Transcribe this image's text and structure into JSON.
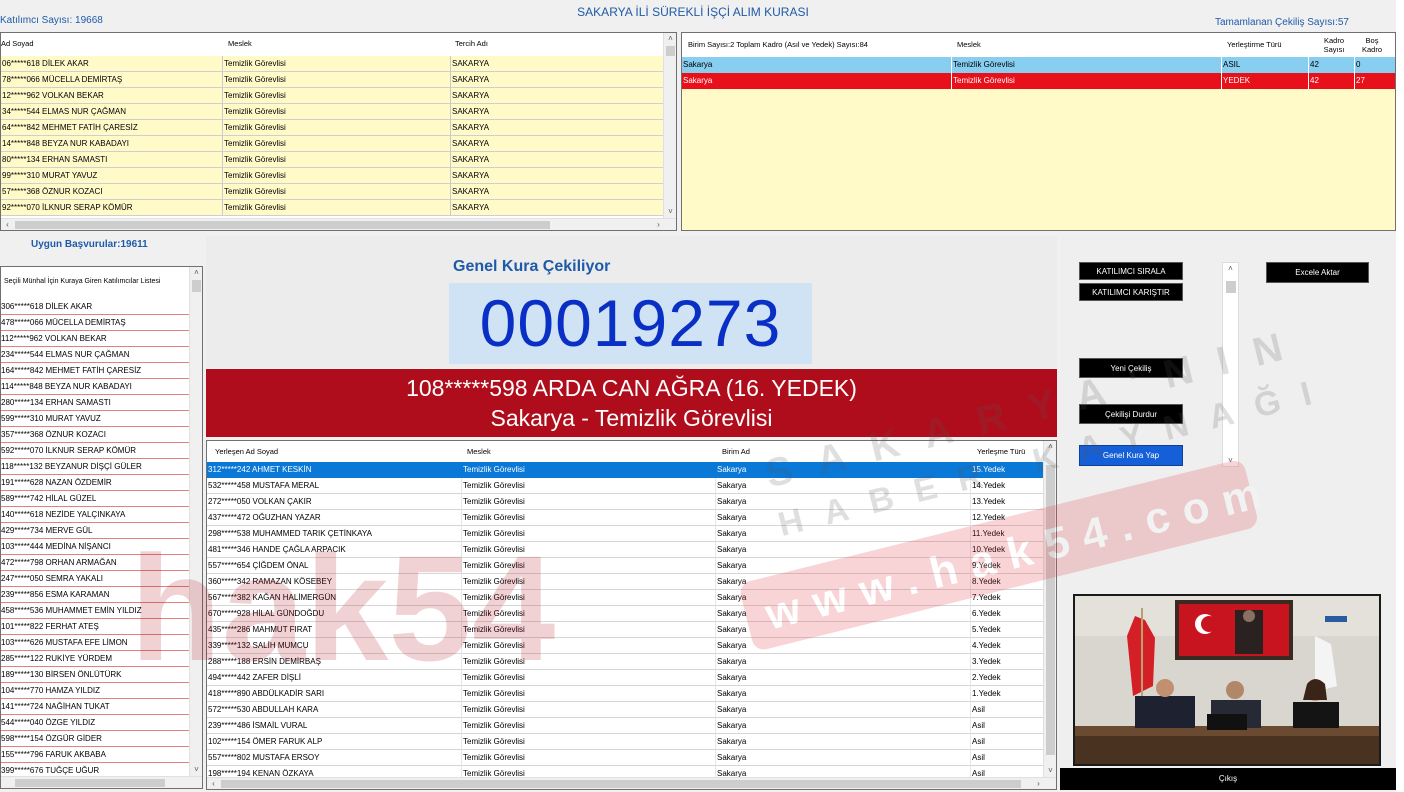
{
  "header": {
    "title": "SAKARYA İLİ SÜREKLİ İŞÇİ ALIM KURASI",
    "participants": "Katılımcı Sayısı: 19668",
    "completed": "Tamamlanan Çekiliş Sayısı:57"
  },
  "participant_grid": {
    "columns": [
      "Ad Soyad",
      "Meslek",
      "Tercih Adı"
    ],
    "rows": [
      [
        "06*****618 DİLEK AKAR",
        "Temizlik Görevlisi",
        "SAKARYA"
      ],
      [
        "78*****066 MÜCELLA DEMİRTAŞ",
        "Temizlik Görevlisi",
        "SAKARYA"
      ],
      [
        "12*****962 VOLKAN BEKAR",
        "Temizlik Görevlisi",
        "SAKARYA"
      ],
      [
        "34*****544 ELMAS NUR ÇAĞMAN",
        "Temizlik Görevlisi",
        "SAKARYA"
      ],
      [
        "64*****842 MEHMET FATİH ÇARESİZ",
        "Temizlik Görevlisi",
        "SAKARYA"
      ],
      [
        "14*****848 BEYZA NUR KABADAYI",
        "Temizlik Görevlisi",
        "SAKARYA"
      ],
      [
        "80*****134 ERHAN SAMASTI",
        "Temizlik Görevlisi",
        "SAKARYA"
      ],
      [
        "99*****310 MURAT YAVUZ",
        "Temizlik Görevlisi",
        "SAKARYA"
      ],
      [
        "57*****368 ÖZNUR KOZACI",
        "Temizlik Görevlisi",
        "SAKARYA"
      ],
      [
        "92*****070 İLKNUR SERAP KÖMÜR",
        "Temizlik Görevlisi",
        "SAKARYA"
      ]
    ]
  },
  "unit_grid": {
    "columns": [
      "Birim Sayısı:2 Toplam Kadro (Asıl ve Yedek) Sayısı:84",
      "Meslek",
      "Yerleştirme Türü",
      "Kadro Sayısı",
      "Boş Kadro"
    ],
    "rows": [
      [
        "Sakarya",
        "Temizlik Görevlisi",
        "ASIL",
        "42",
        "0"
      ],
      [
        "Sakarya",
        "Temizlik Görevlisi",
        "YEDEK",
        "42",
        "27"
      ]
    ],
    "row_colors": [
      "#87cef0",
      "#e8101a"
    ]
  },
  "eligible": {
    "title": "Uygun Başvurular:19611",
    "list_title": "Seçili Münhal İçin Kuraya Giren Katılımcılar Listesi",
    "items": [
      "306*****618 DİLEK AKAR",
      "478*****066 MÜCELLA DEMİRTAŞ",
      "112*****962 VOLKAN BEKAR",
      "234*****544 ELMAS NUR ÇAĞMAN",
      "164*****842 MEHMET FATİH ÇARESİZ",
      "114*****848 BEYZA NUR KABADAYI",
      "280*****134 ERHAN SAMASTI",
      "599*****310 MURAT YAVUZ",
      "357*****368 ÖZNUR KOZACI",
      "592*****070 İLKNUR SERAP KÖMÜR",
      "118*****132 BEYZANUR DİŞÇİ GÜLER",
      "191*****628 NAZAN ÖZDEMİR",
      "589*****742 HİLAL GÜZEL",
      "140*****618 NEZİDE YALÇINKAYA",
      "429*****734 MERVE GÜL",
      "103*****444 MEDİNA NİŞANCI",
      "472*****798 ORHAN ARMAĞAN",
      "247*****050 SEMRA YAKALI",
      "239*****856 ESMA KARAMAN",
      "458*****536 MUHAMMET EMİN YILDIZ",
      "101*****822 FERHAT ATEŞ",
      "103*****626 MUSTAFA EFE LİMON",
      "285*****122 RUKİYE YÜRDEM",
      "189*****130 BİRSEN ÖNLÜTÜRK",
      "104*****770 HAMZA YILDIZ",
      "141*****724 NAĞİHAN TUKAT",
      "544*****040 ÖZGE YILDIZ",
      "598*****154 ÖZGÜR GİDER",
      "155*****796 FARUK AKBABA",
      "399*****676 TUĞÇE UĞUR"
    ]
  },
  "draw": {
    "heading": "Genel Kura Çekiliyor",
    "number": "00019273",
    "winner_line1": "108*****598 ARDA CAN AĞRA (16. YEDEK)",
    "winner_line2": "Sakarya - Temizlik Görevlisi"
  },
  "placed_grid": {
    "columns": [
      "Yerleşen Ad Soyad",
      "Meslek",
      "Birim Ad",
      "Yerleşme Türü"
    ],
    "rows": [
      [
        "312*****242 AHMET KESKİN",
        "Temizlik Görevlisi",
        "Sakarya",
        "15.Yedek"
      ],
      [
        "532*****458 MUSTAFA MERAL",
        "Temizlik Görevlisi",
        "Sakarya",
        "14.Yedek"
      ],
      [
        "272*****050 VOLKAN ÇAKIR",
        "Temizlik Görevlisi",
        "Sakarya",
        "13.Yedek"
      ],
      [
        "437*****472 OĞUZHAN YAZAR",
        "Temizlik Görevlisi",
        "Sakarya",
        "12.Yedek"
      ],
      [
        "298*****538 MUHAMMED TARIK ÇETİNKAYA",
        "Temizlik Görevlisi",
        "Sakarya",
        "11.Yedek"
      ],
      [
        "481*****346 HANDE ÇAĞLA ARPACIK",
        "Temizlik Görevlisi",
        "Sakarya",
        "10.Yedek"
      ],
      [
        "557*****654 ÇİĞDEM ÖNAL",
        "Temizlik Görevlisi",
        "Sakarya",
        "9.Yedek"
      ],
      [
        "360*****342 RAMAZAN KÖSEBEY",
        "Temizlik Görevlisi",
        "Sakarya",
        "8.Yedek"
      ],
      [
        "567*****382 KAĞAN HALİMERGÜN",
        "Temizlik Görevlisi",
        "Sakarya",
        "7.Yedek"
      ],
      [
        "670*****928 HİLAL GÜNDOĞDU",
        "Temizlik Görevlisi",
        "Sakarya",
        "6.Yedek"
      ],
      [
        "435*****286 MAHMUT FIRAT",
        "Temizlik Görevlisi",
        "Sakarya",
        "5.Yedek"
      ],
      [
        "339*****132 SALİH MUMCU",
        "Temizlik Görevlisi",
        "Sakarya",
        "4.Yedek"
      ],
      [
        "288*****188 ERSİN DEMİRBAŞ",
        "Temizlik Görevlisi",
        "Sakarya",
        "3.Yedek"
      ],
      [
        "494*****442 ZAFER DİŞLİ",
        "Temizlik Görevlisi",
        "Sakarya",
        "2.Yedek"
      ],
      [
        "418*****890 ABDÜLKADİR SARI",
        "Temizlik Görevlisi",
        "Sakarya",
        "1.Yedek"
      ],
      [
        "572*****530 ABDULLAH KARA",
        "Temizlik Görevlisi",
        "Sakarya",
        "Asil"
      ],
      [
        "239*****486 İSMAİL VURAL",
        "Temizlik Görevlisi",
        "Sakarya",
        "Asil"
      ],
      [
        "102*****154 ÖMER FARUK ALP",
        "Temizlik Görevlisi",
        "Sakarya",
        "Asil"
      ],
      [
        "557*****802 MUSTAFA ERSOY",
        "Temizlik Görevlisi",
        "Sakarya",
        "Asil"
      ],
      [
        "198*****194 KENAN ÖZKAYA",
        "Temizlik Görevlisi",
        "Sakarya",
        "Asil"
      ]
    ]
  },
  "controls": {
    "sort": "KATILIMCI SIRALA",
    "shuffle": "KATILIMCI KARIŞTIR",
    "export": "Excele Aktar",
    "new_draw": "Yeni Çekiliş",
    "stop": "Çekilişi Durdur",
    "general": "Genel Kura Yap",
    "exit": "Çıkış"
  },
  "watermark": {
    "text1": "hak54",
    "text2": "www.hak54.com",
    "text3": "SAKARYA'NIN",
    "text4": "HABER KAYNAĞI"
  },
  "colors": {
    "accent_blue": "#1e5aa8",
    "grid_yellow": "#fffac8",
    "banner_red": "#b00d1c",
    "selection_blue": "#0a78d7",
    "number_blue": "#0a2fc4"
  }
}
